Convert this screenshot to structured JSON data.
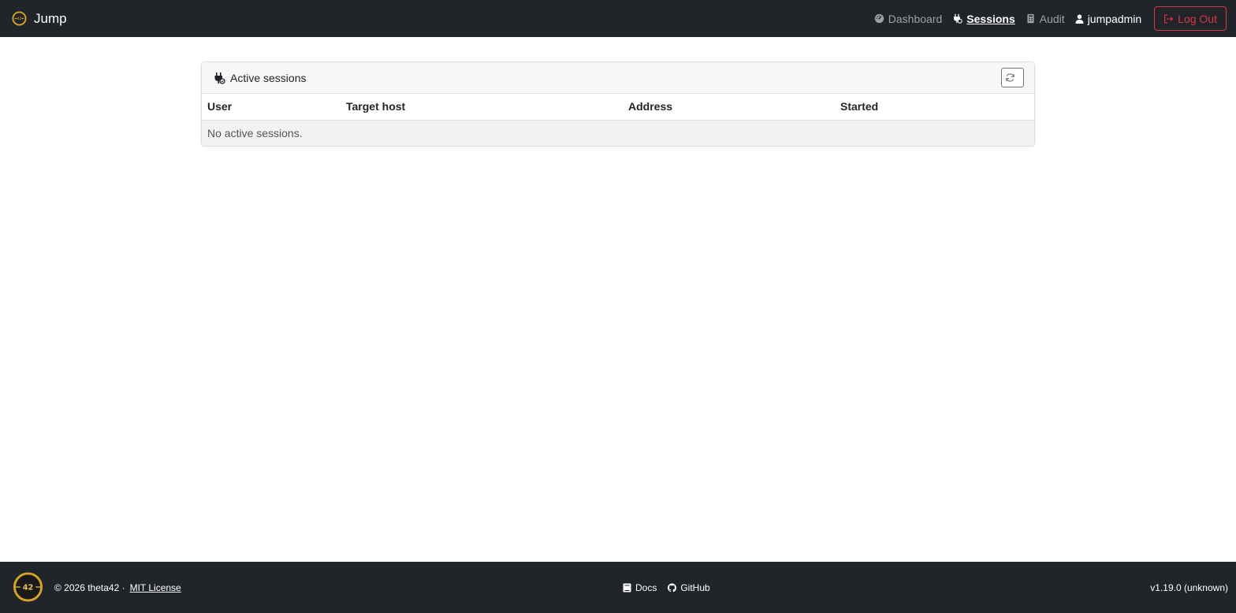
{
  "navbar": {
    "brand": "Jump",
    "links": [
      {
        "label": "Dashboard",
        "icon": "dashboard-icon",
        "active": false
      },
      {
        "label": "Sessions",
        "icon": "plug-icon",
        "active": true
      },
      {
        "label": "Audit",
        "icon": "audit-icon",
        "active": false
      }
    ],
    "user": "jumpadmin",
    "logout_label": "Log Out"
  },
  "sessions_card": {
    "title": "Active sessions",
    "columns": [
      "User",
      "Target host",
      "Address",
      "Started"
    ],
    "empty_message": "No active sessions."
  },
  "footer": {
    "logo_text": "42",
    "copyright": "© 2026 theta42 ·",
    "license_link": "MIT License",
    "docs_link": "Docs",
    "github_link": "GitHub",
    "version": "v1.19.0 (unknown)"
  },
  "colors": {
    "navbar_bg": "#212529",
    "logout_red": "#dc3545",
    "logo_gold": "#d4a429"
  }
}
